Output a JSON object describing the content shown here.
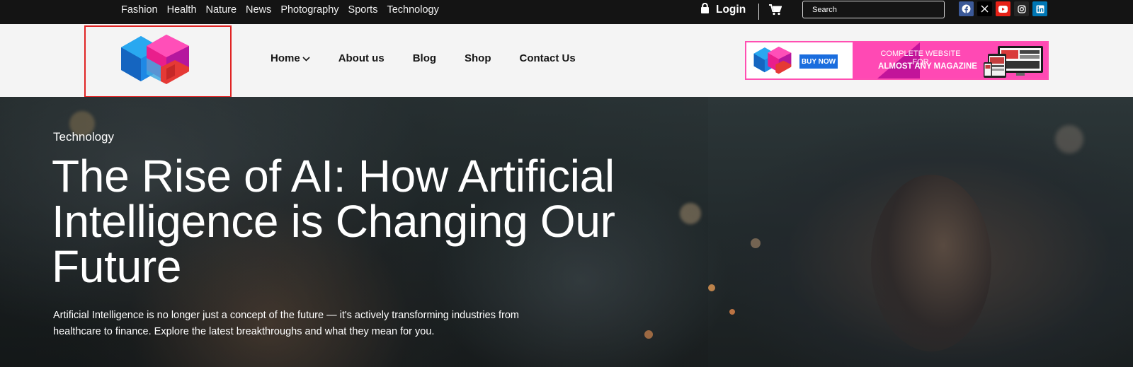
{
  "topbar": {
    "categories": [
      "Fashion",
      "Health",
      "Nature",
      "News",
      "Photography",
      "Sports",
      "Technology"
    ],
    "login_label": "Login",
    "search_placeholder": "Search",
    "socials": [
      {
        "name": "facebook-icon",
        "color": "#3b5998"
      },
      {
        "name": "x-icon",
        "color": "#000000"
      },
      {
        "name": "youtube-icon",
        "color": "#e62117"
      },
      {
        "name": "instagram-icon",
        "color": "#262626"
      },
      {
        "name": "linkedin-icon",
        "color": "#0077b5"
      }
    ]
  },
  "header": {
    "nav": [
      "Home",
      "About us",
      "Blog",
      "Shop",
      "Contact Us"
    ],
    "banner": {
      "buy_label": "BUY NOW",
      "line1": "COMPLETE WEBSITE FOR",
      "line2": "ALMOST ANY MAGAZINE"
    }
  },
  "hero": {
    "category": "Technology",
    "title": "The Rise of AI: How Artificial Intelligence is Changing Our Future",
    "description": "Artificial Intelligence is no longer just a concept of the future — it's actively transforming industries from healthcare to finance. Explore the latest breakthroughs and what they mean for you."
  },
  "colors": {
    "topbar_bg": "#141414",
    "header_bg": "#f4f4f4",
    "logo_highlight_border": "#e02424",
    "banner_pink": "#ff49b4",
    "buy_button": "#1a6dde"
  }
}
